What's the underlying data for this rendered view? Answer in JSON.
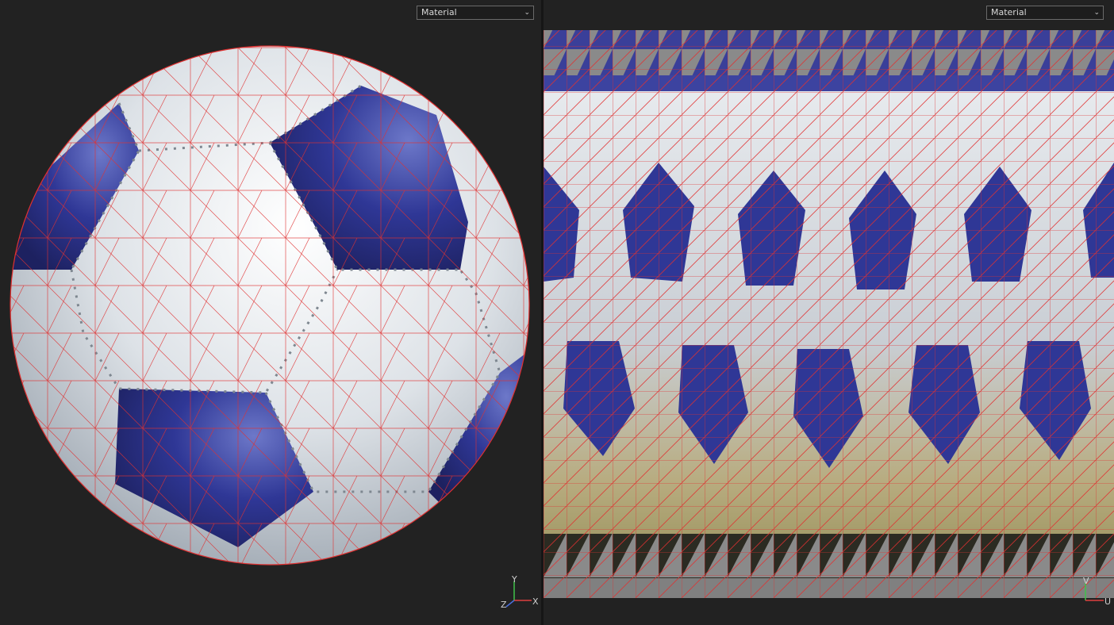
{
  "viewport3d": {
    "shading_label": "Material",
    "axis": {
      "x": "X",
      "y": "Y",
      "z": "Z"
    }
  },
  "uv_view": {
    "shading_label": "Material",
    "axis": {
      "u": "U",
      "v": "V"
    }
  },
  "colors": {
    "background": "#222222",
    "wireframe": "#e03030",
    "patch_blue": "#2a2f8a",
    "patch_white": "#d7dde3",
    "uv_gray": "#808080"
  }
}
